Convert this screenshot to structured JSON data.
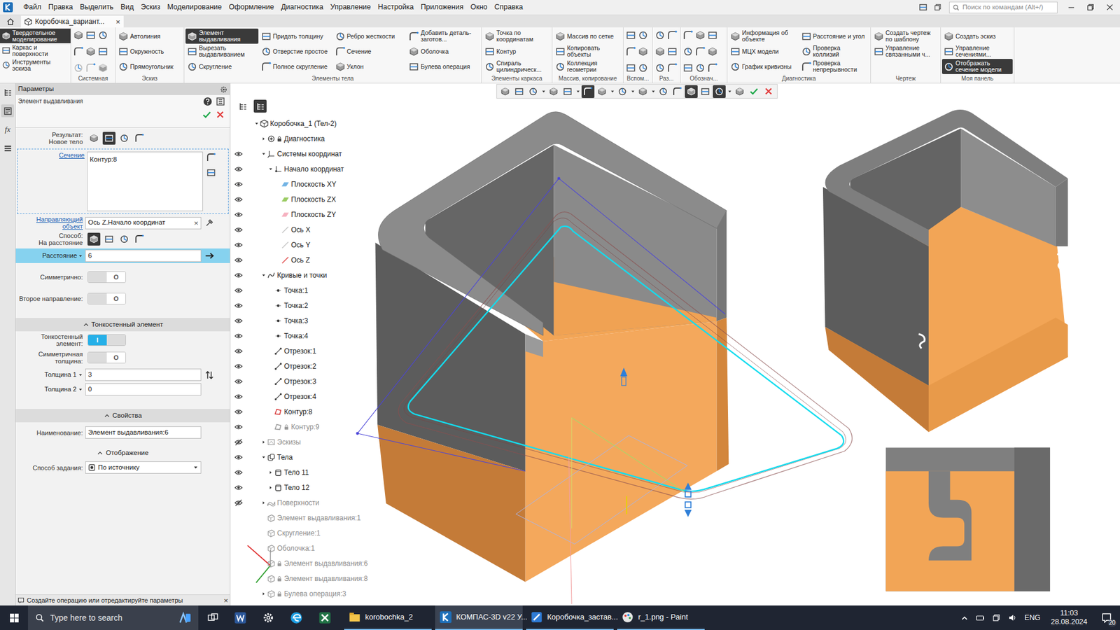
{
  "menu_bar": {
    "items": [
      "Файл",
      "Правка",
      "Выделить",
      "Вид",
      "Эскиз",
      "Моделирование",
      "Оформление",
      "Диагностика",
      "Управление",
      "Настройка",
      "Приложения",
      "Окно",
      "Справка"
    ],
    "search_placeholder": "Поиск по командам (Alt+/)"
  },
  "doc_tabs": [
    {
      "label": "Коробочка_вариант...",
      "selected": true,
      "close": "×"
    }
  ],
  "ribbon": {
    "modes": [
      {
        "label": "Твердотельное моделирование",
        "selected": true
      },
      {
        "label": "Каркас и поверхности",
        "selected": false
      },
      {
        "label": "Инструменты эскиза",
        "selected": false
      }
    ],
    "groups": [
      {
        "label": "Системная",
        "kind": "icons",
        "columns": []
      },
      {
        "label": "Эскиз",
        "kind": "buttons",
        "columns": [
          [
            {
              "label": "Автолиния",
              "selected": false
            },
            {
              "label": "Окружность",
              "selected": false
            },
            {
              "label": "Прямоугольник",
              "selected": false
            }
          ]
        ]
      },
      {
        "label": "Элементы тела",
        "kind": "buttons",
        "columns": [
          [
            {
              "label": "Элемент выдавливания",
              "selected": true
            },
            {
              "label": "Вырезать выдавливанием",
              "selected": false
            },
            {
              "label": "Скругление",
              "selected": false
            }
          ],
          [
            {
              "label": "Придать толщину",
              "selected": false
            },
            {
              "label": "Отверстие простое",
              "selected": false
            },
            {
              "label": "Полное скругление",
              "selected": false
            }
          ],
          [
            {
              "label": "Ребро жесткости",
              "selected": false
            },
            {
              "label": "Сечение",
              "selected": false
            },
            {
              "label": "Уклон",
              "selected": false
            }
          ],
          [
            {
              "label": "Добавить деталь-заготов...",
              "selected": false
            },
            {
              "label": "Оболочка",
              "selected": false
            },
            {
              "label": "Булева операция",
              "selected": false
            }
          ]
        ]
      },
      {
        "label": "Элементы каркаса",
        "kind": "buttons",
        "columns": [
          [
            {
              "label": "Точка по координатам",
              "selected": false
            },
            {
              "label": "Контур",
              "selected": false
            },
            {
              "label": "Спираль цилиндрическ...",
              "selected": false
            }
          ]
        ]
      },
      {
        "label": "Массив, копирование",
        "kind": "buttons",
        "columns": [
          [
            {
              "label": "Массив по сетке",
              "selected": false
            },
            {
              "label": "Копировать объекты",
              "selected": false
            },
            {
              "label": "Коллекция геометрии",
              "selected": false
            }
          ]
        ]
      },
      {
        "label": "Вспом...",
        "kind": "icons",
        "columns": []
      },
      {
        "label": "Раз...",
        "kind": "icons",
        "columns": []
      },
      {
        "label": "Обознач...",
        "kind": "icons",
        "columns": []
      },
      {
        "label": "Диагностика",
        "kind": "buttons",
        "columns": [
          [
            {
              "label": "Информация об объекте",
              "selected": false
            },
            {
              "label": "МЦХ модели",
              "selected": false
            },
            {
              "label": "График кривизны",
              "selected": false
            }
          ],
          [
            {
              "label": "Расстояние и угол",
              "selected": false
            },
            {
              "label": "Проверка коллизий",
              "selected": false
            },
            {
              "label": "Проверка непрерывности",
              "selected": false
            }
          ]
        ]
      },
      {
        "label": "Чертеж",
        "kind": "buttons",
        "columns": [
          [
            {
              "label": "Создать чертеж по шаблону",
              "selected": false
            },
            {
              "label": "Управление связанными ч...",
              "selected": false
            }
          ]
        ]
      },
      {
        "label": "Моя панель",
        "kind": "buttons",
        "columns": [
          [
            {
              "label": "Создать эскиз",
              "selected": false
            },
            {
              "label": "Управление сечениями...",
              "selected": false
            },
            {
              "label": "Отображать сечение модели",
              "selected": true
            }
          ]
        ]
      }
    ]
  },
  "left_strip": [
    {
      "kind": "tree",
      "selected": false,
      "label": ""
    },
    {
      "kind": "params",
      "selected": true,
      "label": ""
    },
    {
      "kind": "formula",
      "selected": false,
      "label": "fx"
    },
    {
      "kind": "menu",
      "selected": false,
      "label": ""
    }
  ],
  "params": {
    "panel_title": "Параметры",
    "operation": "Элемент выдавливания",
    "result": {
      "label": "Результат:",
      "value": "Новое тело",
      "options": [
        {
          "selected": false
        },
        {
          "selected": true
        },
        {
          "selected": false
        },
        {
          "selected": false
        }
      ]
    },
    "section": {
      "label": "Сечение",
      "items": [
        "Контур:8"
      ]
    },
    "direction": {
      "label": "Направляющий объект",
      "value": "Ось Z.Начало координат",
      "clear": "×"
    },
    "method": {
      "label": "Способ:",
      "value": "На расстояние",
      "options": [
        {
          "selected": true
        },
        {
          "selected": false
        },
        {
          "selected": false
        },
        {
          "selected": false
        }
      ]
    },
    "distance": {
      "label": "Расстояние",
      "value": "6",
      "selected": true
    },
    "toggles": [
      {
        "label": "Симметрично:",
        "on": false
      },
      {
        "label": "Второе направление:",
        "on": false
      }
    ],
    "toggle_glyphs": {
      "on": "I",
      "off": "O"
    },
    "thin_wall": {
      "title": "Тонкостенный элемент",
      "kind": "band",
      "expanded": true,
      "toggles": [
        {
          "label": "Тонкостенный элемент:",
          "on": true
        },
        {
          "label": "Симметричная толщина:",
          "on": false
        }
      ],
      "fields": [
        {
          "label": "Толщина 1",
          "value": "3"
        },
        {
          "label": "Толщина 2",
          "value": "0"
        }
      ]
    },
    "properties": {
      "title": "Свойства",
      "kind": "band",
      "expanded": true,
      "fields": [
        {
          "label": "Наименование:",
          "value": "Элемент выдавливания:6"
        }
      ]
    },
    "display": {
      "title": "Отображение",
      "kind": "plain",
      "expanded": true,
      "fields": [
        {
          "label": "Способ задания:",
          "value": "По источнику"
        }
      ]
    },
    "status": {
      "text": "Создайте операцию или отредактируйте параметры",
      "close": "×"
    }
  },
  "tree_toolbar": [
    {
      "selected": false
    },
    {
      "selected": true
    }
  ],
  "tree": [
    {
      "label": "Коробочка_1 (Тел-2)",
      "level": 0,
      "expander": "open",
      "eye": "none",
      "greyed": false,
      "locked": false,
      "icon": "part",
      "color": "#3a3a3a"
    },
    {
      "label": "Диагностика",
      "level": 1,
      "expander": "closed",
      "eye": "none",
      "greyed": false,
      "locked": true,
      "icon": "diag",
      "color": "#3a3a3a"
    },
    {
      "label": "Системы координат",
      "level": 1,
      "expander": "open",
      "eye": "shown",
      "greyed": false,
      "locked": false,
      "icon": "axes",
      "color": "#3a3a3a"
    },
    {
      "label": "Начало координат",
      "level": 2,
      "expander": "open",
      "eye": "shown",
      "greyed": false,
      "locked": false,
      "icon": "origin",
      "color": "#3a3a3a"
    },
    {
      "label": "Плоскость XY",
      "level": 3,
      "expander": "none",
      "eye": "shown",
      "greyed": false,
      "locked": false,
      "icon": "plane",
      "color": "#5aa7e0"
    },
    {
      "label": "Плоскость ZX",
      "level": 3,
      "expander": "none",
      "eye": "shown",
      "greyed": false,
      "locked": false,
      "icon": "plane",
      "color": "#8bc34a"
    },
    {
      "label": "Плоскость ZY",
      "level": 3,
      "expander": "none",
      "eye": "shown",
      "greyed": false,
      "locked": false,
      "icon": "plane",
      "color": "#f4a3b5"
    },
    {
      "label": "Ось X",
      "level": 3,
      "expander": "none",
      "eye": "shown",
      "greyed": false,
      "locked": false,
      "icon": "axis",
      "color": "#c4c4c4"
    },
    {
      "label": "Ось Y",
      "level": 3,
      "expander": "none",
      "eye": "shown",
      "greyed": false,
      "locked": false,
      "icon": "axis",
      "color": "#c4c4c4"
    },
    {
      "label": "Ось Z",
      "level": 3,
      "expander": "none",
      "eye": "shown",
      "greyed": false,
      "locked": false,
      "icon": "axis",
      "color": "#e04848"
    },
    {
      "label": "Кривые и точки",
      "level": 1,
      "expander": "open",
      "eye": "shown",
      "greyed": false,
      "locked": false,
      "icon": "curves",
      "color": "#3a3a3a"
    },
    {
      "label": "Точка:1",
      "level": 2,
      "expander": "none",
      "eye": "shown",
      "greyed": false,
      "locked": false,
      "icon": "point",
      "color": "#3a3a3a"
    },
    {
      "label": "Точка:2",
      "level": 2,
      "expander": "none",
      "eye": "shown",
      "greyed": false,
      "locked": false,
      "icon": "point",
      "color": "#3a3a3a"
    },
    {
      "label": "Точка:3",
      "level": 2,
      "expander": "none",
      "eye": "shown",
      "greyed": false,
      "locked": false,
      "icon": "point",
      "color": "#3a3a3a"
    },
    {
      "label": "Точка:4",
      "level": 2,
      "expander": "none",
      "eye": "shown",
      "greyed": false,
      "locked": false,
      "icon": "point",
      "color": "#3a3a3a"
    },
    {
      "label": "Отрезок:1",
      "level": 2,
      "expander": "none",
      "eye": "shown",
      "greyed": false,
      "locked": false,
      "icon": "segment",
      "color": "#3a3a3a"
    },
    {
      "label": "Отрезок:2",
      "level": 2,
      "expander": "none",
      "eye": "shown",
      "greyed": false,
      "locked": false,
      "icon": "segment",
      "color": "#3a3a3a"
    },
    {
      "label": "Отрезок:3",
      "level": 2,
      "expander": "none",
      "eye": "shown",
      "greyed": false,
      "locked": false,
      "icon": "segment",
      "color": "#3a3a3a"
    },
    {
      "label": "Отрезок:4",
      "level": 2,
      "expander": "none",
      "eye": "shown",
      "greyed": false,
      "locked": false,
      "icon": "segment",
      "color": "#3a3a3a"
    },
    {
      "label": "Контур:8",
      "level": 2,
      "expander": "none",
      "eye": "shown",
      "greyed": false,
      "locked": false,
      "icon": "contour",
      "color": "#d83c3c"
    },
    {
      "label": "Контур:9",
      "level": 2,
      "expander": "none",
      "eye": "shown",
      "greyed": true,
      "locked": true,
      "icon": "contour",
      "color": "#a0a0a0"
    },
    {
      "label": "Эскизы",
      "level": 1,
      "expander": "closed",
      "eye": "hidden",
      "greyed": true,
      "locked": false,
      "icon": "sketch",
      "color": "#9a9a9a"
    },
    {
      "label": "Тела",
      "level": 1,
      "expander": "open",
      "eye": "shown",
      "greyed": false,
      "locked": false,
      "icon": "bodies",
      "color": "#3a3a3a"
    },
    {
      "label": "Тело 11",
      "level": 2,
      "expander": "closed",
      "eye": "shown",
      "greyed": false,
      "locked": false,
      "icon": "body",
      "color": "#3a3a3a"
    },
    {
      "label": "Тело 12",
      "level": 2,
      "expander": "closed",
      "eye": "shown",
      "greyed": false,
      "locked": false,
      "icon": "body",
      "color": "#3a3a3a"
    },
    {
      "label": "Поверхности",
      "level": 1,
      "expander": "closed",
      "eye": "hidden",
      "greyed": true,
      "locked": false,
      "icon": "surface",
      "color": "#9a9a9a"
    },
    {
      "label": "Элемент выдавливания:1",
      "level": 1,
      "expander": "none",
      "eye": "none",
      "greyed": true,
      "locked": false,
      "icon": "op",
      "color": "#9a9a9a"
    },
    {
      "label": "Скругление:1",
      "level": 1,
      "expander": "none",
      "eye": "none",
      "greyed": true,
      "locked": false,
      "icon": "op",
      "color": "#9a9a9a"
    },
    {
      "label": "Оболочка:1",
      "level": 1,
      "expander": "none",
      "eye": "none",
      "greyed": true,
      "locked": false,
      "icon": "op",
      "color": "#9a9a9a"
    },
    {
      "label": "Элемент выдавливания:6",
      "level": 1,
      "expander": "none",
      "eye": "none",
      "greyed": true,
      "locked": true,
      "icon": "op",
      "color": "#9a9a9a"
    },
    {
      "label": "Элемент выдавливания:8",
      "level": 1,
      "expander": "none",
      "eye": "none",
      "greyed": true,
      "locked": true,
      "icon": "op",
      "color": "#9a9a9a"
    },
    {
      "label": "Булева операция:3",
      "level": 1,
      "expander": "closed",
      "eye": "none",
      "greyed": true,
      "locked": true,
      "icon": "op",
      "color": "#9a9a9a"
    }
  ],
  "canvas_toolbar": [
    {
      "kind": "tool",
      "selected": false
    },
    {
      "kind": "tool",
      "selected": false
    },
    {
      "kind": "tool",
      "selected": false
    },
    {
      "kind": "caret",
      "selected": false
    },
    {
      "kind": "tool",
      "selected": false
    },
    {
      "kind": "tool",
      "selected": false
    },
    {
      "kind": "caret",
      "selected": false
    },
    {
      "kind": "tool",
      "selected": true
    },
    {
      "kind": "tool",
      "selected": false
    },
    {
      "kind": "caret",
      "selected": false
    },
    {
      "kind": "tool",
      "selected": false
    },
    {
      "kind": "caret",
      "selected": false
    },
    {
      "kind": "tool",
      "selected": false
    },
    {
      "kind": "caret",
      "selected": false
    },
    {
      "kind": "tool",
      "selected": false
    },
    {
      "kind": "tool",
      "selected": false
    },
    {
      "kind": "tool",
      "selected": true
    },
    {
      "kind": "tool",
      "selected": false
    },
    {
      "kind": "tool",
      "selected": true
    },
    {
      "kind": "caret",
      "selected": false
    },
    {
      "kind": "tool",
      "selected": false
    },
    {
      "kind": "ok",
      "selected": false
    },
    {
      "kind": "cancel",
      "selected": false
    }
  ],
  "taskbar": {
    "search_placeholder": "Type here to search",
    "apps": [
      {
        "label": "korobochka_2",
        "selected": false,
        "icon": "explorer"
      },
      {
        "label": "КОМПАС-3D v22 У...",
        "selected": true,
        "icon": "kompas"
      },
      {
        "label": "Коробочка_застав...",
        "selected": false,
        "icon": "paint3d"
      },
      {
        "label": "r_1.png - Paint",
        "selected": false,
        "icon": "paint"
      }
    ],
    "language": "ENG",
    "time": "11:03",
    "date": "28.08.2024",
    "notifications": "20"
  }
}
